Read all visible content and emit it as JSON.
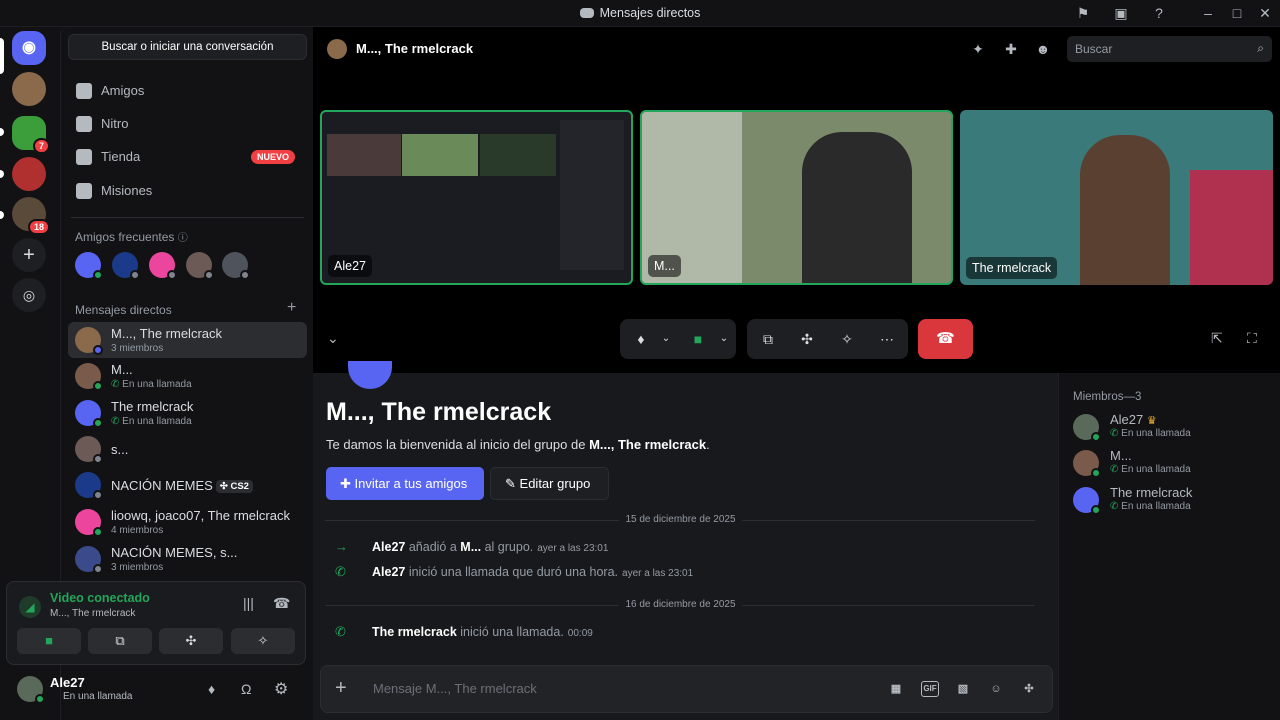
{
  "window": {
    "title": "Mensajes directos"
  },
  "sidebar": {
    "search_label": "Buscar o iniciar una conversación",
    "nav": [
      {
        "label": "Amigos"
      },
      {
        "label": "Nitro"
      },
      {
        "label": "Tienda",
        "badge": "NUEVO"
      },
      {
        "label": "Misiones"
      }
    ],
    "frequent_title": "Amigos frecuentes",
    "dm_title": "Mensajes directos",
    "dms": [
      {
        "name": "M..., The rmelcrack",
        "sub": "3 miembros"
      },
      {
        "name": "M...",
        "sub": "En una llamada"
      },
      {
        "name": "The rmelcrack",
        "sub": "En una llamada"
      },
      {
        "name": "s...",
        "sub": ""
      },
      {
        "name": "NACIÓN MEMES",
        "sub": "",
        "tag": "CS2"
      },
      {
        "name": "lioowq, joaco07, The rmelcrack",
        "sub": "4 miembros"
      },
      {
        "name": "NACIÓN MEMES, s...",
        "sub": "3 miembros"
      }
    ]
  },
  "servers": {
    "badges": [
      "7",
      "18"
    ]
  },
  "voice": {
    "status": "Video conectado",
    "channel": "M..., The rmelcrack"
  },
  "user": {
    "name": "Ale27",
    "status": "En una llamada"
  },
  "header": {
    "title": "M..., The rmelcrack",
    "search_placeholder": "Buscar"
  },
  "call": {
    "tiles": [
      {
        "label": "Ale27"
      },
      {
        "label": "M..."
      },
      {
        "label": "The rmelcrack"
      }
    ]
  },
  "welcome": {
    "title": "M..., The rmelcrack",
    "text_prefix": "Te damos la bienvenida al inicio del grupo de ",
    "text_bold": "M..., The rmelcrack",
    "text_suffix": ".",
    "invite_btn": "Invitar a tus amigos",
    "edit_btn": "Editar grupo"
  },
  "messages": [
    {
      "date": "15 de diciembre de 2025"
    },
    {
      "user": "Ale27",
      "text1": " añadió a ",
      "target": "M...",
      "text2": " al grupo.",
      "time": "ayer a las 23:01"
    },
    {
      "user": "Ale27",
      "text1": " inició una llamada que duró una hora.",
      "time": "ayer a las 23:01"
    },
    {
      "date": "16 de diciembre de 2025"
    },
    {
      "user": "The rmelcrack",
      "text1": " inició una llamada.",
      "time": "00:09"
    }
  ],
  "composer": {
    "placeholder": "Mensaje M..., The rmelcrack",
    "gif": "GIF"
  },
  "members": {
    "title": "Miembros—3",
    "list": [
      {
        "name": "Ale27",
        "sub": "En una llamada",
        "crown": "♛"
      },
      {
        "name": "M...",
        "sub": "En una llamada"
      },
      {
        "name": "The rmelcrack",
        "sub": "En una llamada"
      }
    ]
  },
  "colors": {
    "accent": "#5865f2",
    "online": "#23a55a",
    "danger": "#da373c",
    "badge": "#f23f43"
  }
}
